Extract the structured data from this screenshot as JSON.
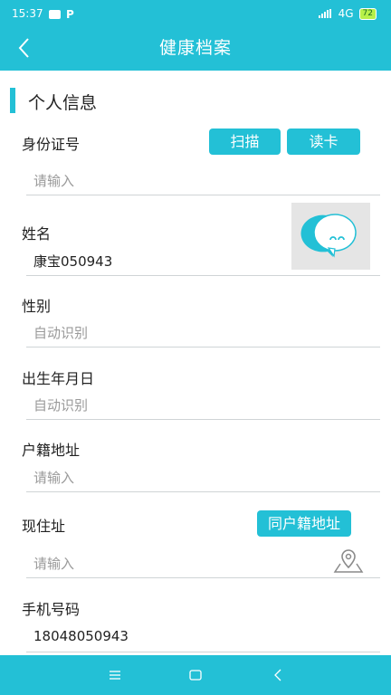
{
  "status": {
    "time": "15:37",
    "network": "4G",
    "battery": "72"
  },
  "header": {
    "title": "健康档案"
  },
  "section": {
    "title": "个人信息"
  },
  "id_number": {
    "label": "身份证号",
    "scan_label": "扫描",
    "read_card_label": "读卡",
    "placeholder": "请输入"
  },
  "name": {
    "label": "姓名",
    "value": "康宝050943"
  },
  "gender": {
    "label": "性别",
    "placeholder": "自动识别"
  },
  "birthdate": {
    "label": "出生年月日",
    "placeholder": "自动识别"
  },
  "household_address": {
    "label": "户籍地址",
    "placeholder": "请输入"
  },
  "current_address": {
    "label": "现住址",
    "same_button_label": "同户籍地址",
    "placeholder": "请输入"
  },
  "phone": {
    "label": "手机号码",
    "value": "18048050943"
  },
  "icons": {
    "back": "chevron-left-icon",
    "location": "location-pin-icon",
    "avatar": "chat-bubble-avatar-icon",
    "nav_menu": "menu-icon",
    "nav_home": "square-home-icon",
    "nav_back": "back-triangle-icon"
  },
  "colors": {
    "accent": "#23c0d6"
  }
}
